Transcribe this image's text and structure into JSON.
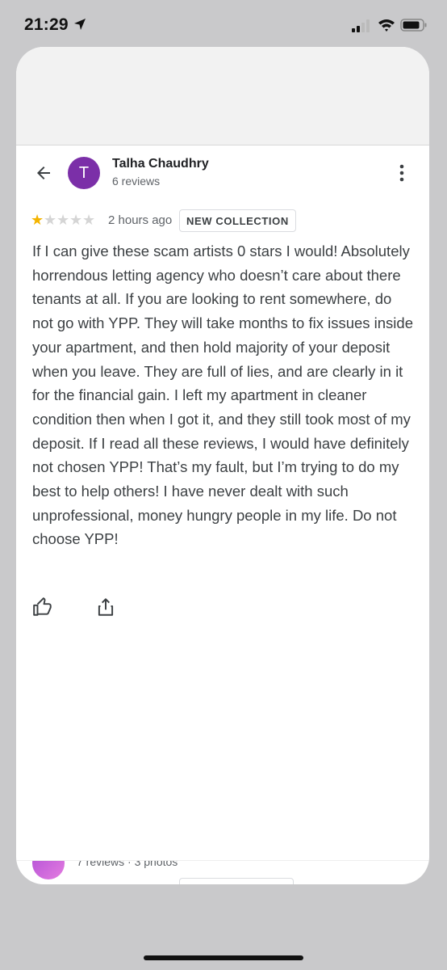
{
  "status_bar": {
    "time": "21:29",
    "icons": [
      "location-arrow-icon",
      "signal-icon",
      "wifi-icon",
      "battery-icon"
    ]
  },
  "review": {
    "reviewer": {
      "initial": "T",
      "name": "Talha Chaudhry",
      "meta": "6 reviews",
      "avatar_color": "#7b2fa8"
    },
    "rating": 1,
    "rating_max": 5,
    "time_ago": "2 hours ago",
    "badge": "NEW COLLECTION",
    "text": "If I can give these scam artists 0 stars I would! Absolutely horrendous letting agency who doesn’t care about there tenants at all. If you are looking to rent somewhere, do not go with YPP. They will take months to fix issues inside your apartment, and then hold majority of your deposit when you leave. They are full of lies, and are clearly in it for the financial gain. I left my apartment in cleaner condition then when I got it, and they still took most of my deposit. If I read all these reviews, I would have definitely not chosen YPP! That’s my fault, but I’m trying to do my best to help others! I have never dealt with such unprofessional, money hungry people in my life. Do not choose YPP!",
    "actions": [
      "thumbs-up-icon",
      "share-icon"
    ]
  },
  "next_review": {
    "meta": "7 reviews · 3 photos"
  },
  "colors": {
    "star_filled": "#f4b400",
    "star_empty": "#d5d5d5",
    "accent_text": "#202124"
  }
}
